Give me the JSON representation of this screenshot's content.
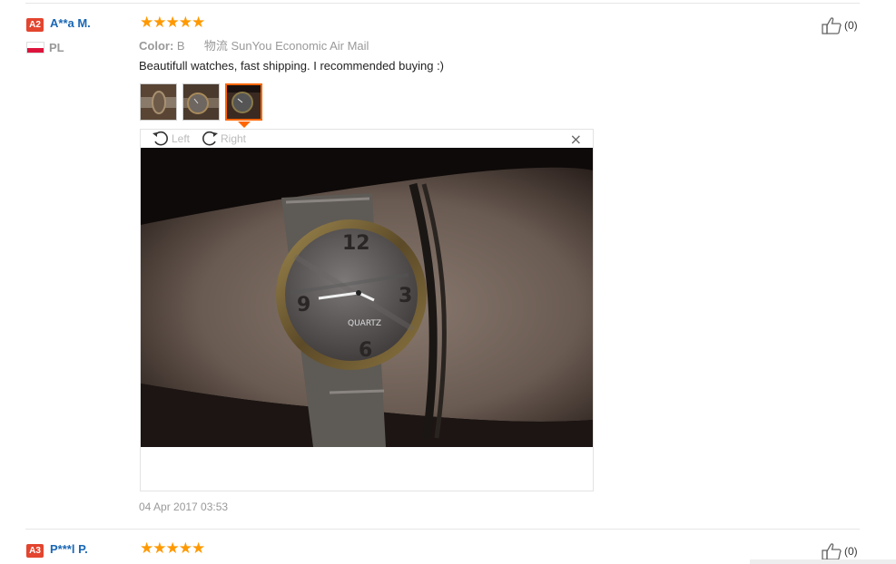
{
  "reviews": [
    {
      "level": "A2",
      "name": "A**a M.",
      "country": "PL",
      "rating": 5,
      "meta_label": "Color:",
      "meta_value": "B",
      "shipping": "物流 SunYou Economic Air Mail",
      "text": "Beautifull watches, fast shipping. I recommended buying :)",
      "helpful_count": "(0)",
      "date": "04 Apr 2017 03:53",
      "viewer": {
        "rotate_left": "Left",
        "rotate_right": "Right",
        "close": "×"
      },
      "watch_label": "QUARTZ"
    },
    {
      "level": "A3",
      "name": "P***l P.",
      "rating": 5,
      "helpful_count": "(0)"
    }
  ],
  "icons": {
    "star": "★",
    "thumbs_up": "thumbs-up-icon",
    "rotate_left": "rotate-left-icon",
    "rotate_right": "rotate-right-icon"
  },
  "colors": {
    "username": "#1a67b5",
    "badge": "#e3452f",
    "star": "#ff9900",
    "active_thumb": "#ff6600"
  }
}
